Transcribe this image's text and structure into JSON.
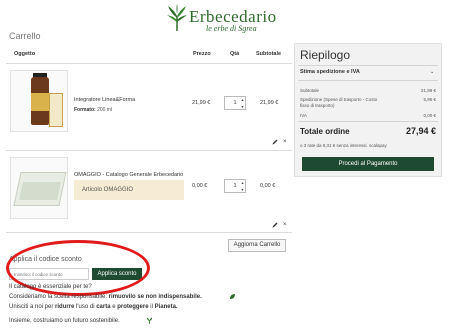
{
  "brand": {
    "name": "Erbecedario",
    "tagline": "le erbe di Sgrea"
  },
  "page": {
    "title": "Carrello"
  },
  "table": {
    "headers": {
      "product": "Oggetto",
      "price": "Prezzo",
      "qty": "Qtà",
      "subtotal": "Subtotale"
    }
  },
  "items": [
    {
      "name": "Integratore Linea&Forma",
      "meta_label": "Formato:",
      "meta_value": "200 ml",
      "price": "21,99 €",
      "qty": "1",
      "subtotal": "21,99 €"
    },
    {
      "name": "OMAGGIO - Catalogo Generale Erbecedario",
      "badge": "Articolo OMAGGIO",
      "price": "0,00 €",
      "qty": "1",
      "subtotal": "0,00 €"
    }
  ],
  "actions": {
    "update_cart": "Aggiorna Carrello"
  },
  "summary": {
    "title": "Riepilogo",
    "shipping_section": "Stima spedizione e IVA",
    "subtotal_label": "Subtotale",
    "subtotal_value": "21,99 €",
    "shipping_label": "Spedizione (Spese di trasporto - Costo fisso di trasporto)",
    "shipping_value": "5,95 €",
    "vat_label": "IVA",
    "vat_value": "0,00 €",
    "total_label": "Totale ordine",
    "total_value": "27,94 €",
    "scalapay_text": "o 3 rate da 9,31 € senza interessi. scalapay",
    "checkout": "Procedi al Pagamento"
  },
  "coupon": {
    "title": "Applica il codice sconto",
    "placeholder": "Inserisci il codice sconto",
    "button": "Applica sconto"
  },
  "eco": {
    "line1_a": "Consideriamo la scelta responsabile: ",
    "line1_b": "rimuovilo se non indispensabile.",
    "line1_pre": "Il catalogo è essenziale per te?",
    "line2_a": "Unisciti a noi per ",
    "line2_b": "ridurre",
    "line2_c": " l'uso di ",
    "line2_d": "carta",
    "line2_e": " e ",
    "line2_f": "proteggere",
    "line2_g": " il ",
    "line2_h": "Pianeta.",
    "line3": "Insieme, costruiamo un futuro sostenibile."
  },
  "colors": {
    "brand_green": "#1f4a32",
    "highlight_red": "#e11b1b",
    "gift_bg": "#f6ebd3"
  }
}
